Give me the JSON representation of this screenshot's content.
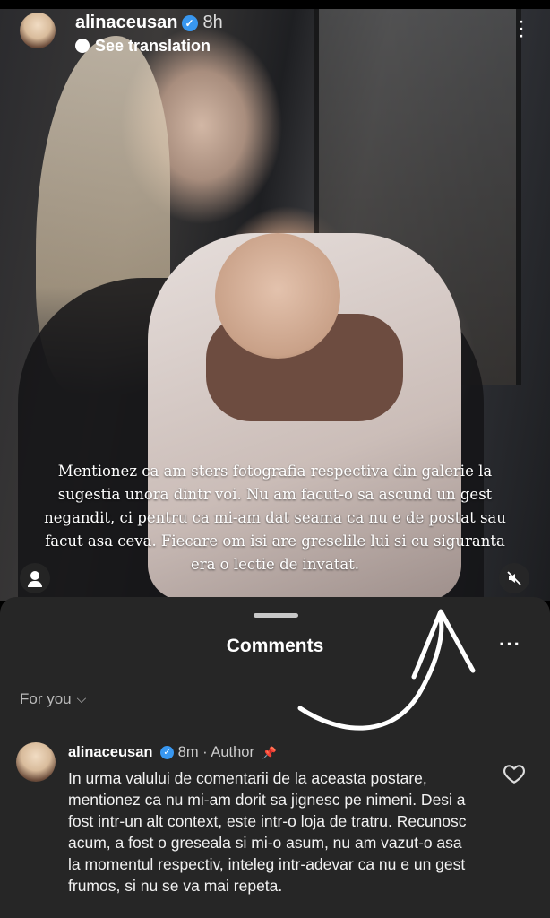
{
  "story": {
    "username": "alinaceusan",
    "time": "8h",
    "see_translation": "See translation",
    "overlay_text": "Mentionez ca am sters fotografia respectiva din galerie la sugestia unora dintr voi. Nu am facut-o sa ascund un gest negandit, ci pentru ca mi-am dat seama ca nu e de postat sau facut asa ceva. Fiecare om isi are greselile lui si cu siguranta era o lectie de invatat.",
    "icons": [
      "verified-badge-icon",
      "globe-icon",
      "more-vertical-icon",
      "user-tag-icon",
      "speaker-muted-icon"
    ]
  },
  "comments_sheet": {
    "title": "Comments",
    "more_icon": "more-horizontal-icon",
    "filter_label": "For you",
    "comments": [
      {
        "username": "alinaceusan",
        "time": "8m",
        "separator": "·",
        "role": "Author",
        "text": "In urma valului de comentarii de la aceasta postare, mentionez ca nu mi-am dorit sa jignesc pe nimeni. Desi a fost intr-un alt context, este intr-o loja de tratru. Recunosc acum, a fost o greseala si mi-o asum, nu am vazut-o asa la momentul respectiv, inteleg intr-adevar ca nu e un gest frumos, si nu se va mai repeta.",
        "icons": [
          "verified-badge-icon",
          "pin-icon",
          "heart-icon"
        ]
      }
    ]
  },
  "colors": {
    "sheet_background": "#262626",
    "verified_blue": "#3897f0",
    "annotation_arrow": "#ffffff"
  }
}
